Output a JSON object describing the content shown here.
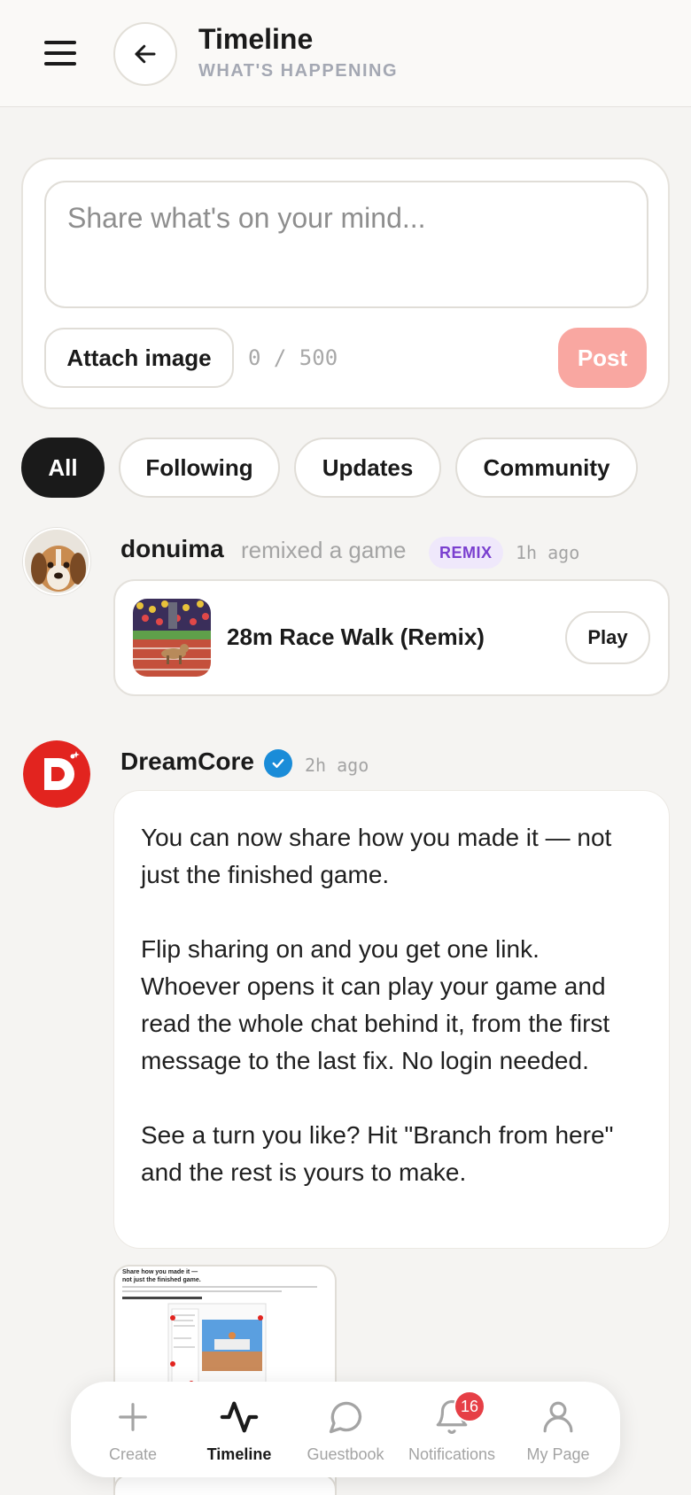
{
  "header": {
    "title": "Timeline",
    "subtitle": "WHAT'S HAPPENING"
  },
  "composer": {
    "placeholder": "Share what's on your mind...",
    "attach_label": "Attach image",
    "char_count": "0 / 500",
    "post_label": "Post"
  },
  "filters": [
    {
      "label": "All",
      "active": true
    },
    {
      "label": "Following",
      "active": false
    },
    {
      "label": "Updates",
      "active": false
    },
    {
      "label": "Community",
      "active": false
    }
  ],
  "feed": [
    {
      "user": "donuima",
      "action": "remixed a game",
      "badge": "REMIX",
      "time": "1h ago",
      "game": {
        "title": "28m Race Walk (Remix)",
        "play_label": "Play"
      }
    },
    {
      "user": "DreamCore",
      "verified": true,
      "time": "2h ago",
      "paragraphs": [
        "You can now share how you made it — not just the finished game.",
        "Flip sharing on and you get one link. Whoever opens it can play your game and read the whole chat behind it, from the first message to the last fix. No login needed.",
        "See a turn you like? Hit \"Branch from here\" and the rest is yours to make."
      ],
      "screenshot_heading": "Share how you made it — not just the finished game."
    }
  ],
  "bottom_nav": [
    {
      "label": "Create",
      "icon": "plus-icon",
      "active": false
    },
    {
      "label": "Timeline",
      "icon": "pulse-icon",
      "active": true
    },
    {
      "label": "Guestbook",
      "icon": "chat-bubble-icon",
      "active": false
    },
    {
      "label": "Notifications",
      "icon": "bell-icon",
      "active": false,
      "badge": "16"
    },
    {
      "label": "My Page",
      "icon": "person-icon",
      "active": false
    }
  ],
  "colors": {
    "accent_post": "#f9a7a1",
    "remix_badge_bg": "#efe8fb",
    "remix_badge_text": "#7a3fcf",
    "verified": "#1a8cd8",
    "notification_badge": "#e63f46",
    "brand_red": "#e2241f"
  }
}
